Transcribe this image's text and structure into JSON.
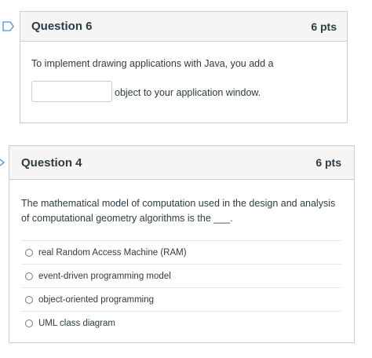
{
  "question6": {
    "title": "Question 6",
    "points": "6 pts",
    "text_before": "To implement drawing applications with Java, you add a",
    "blank_value": "",
    "text_after": "object to your application window."
  },
  "question4": {
    "title": "Question 4",
    "points": "6 pts",
    "prompt": "The mathematical model of computation used in the design and analysis of computational geometry algorithms is the ___.",
    "answers": [
      "real Random Access Machine (RAM)",
      "event-driven programming model",
      "object-oriented programming",
      "UML class diagram"
    ]
  },
  "icons": {
    "question6_flag": "bookmark-flag-icon",
    "question4_flag": "bookmark-flag-icon"
  },
  "colors": {
    "header_bg": "#f5f5f5",
    "border": "#c7cdd1",
    "text": "#2d3b45",
    "flag": "#4a90d9"
  }
}
